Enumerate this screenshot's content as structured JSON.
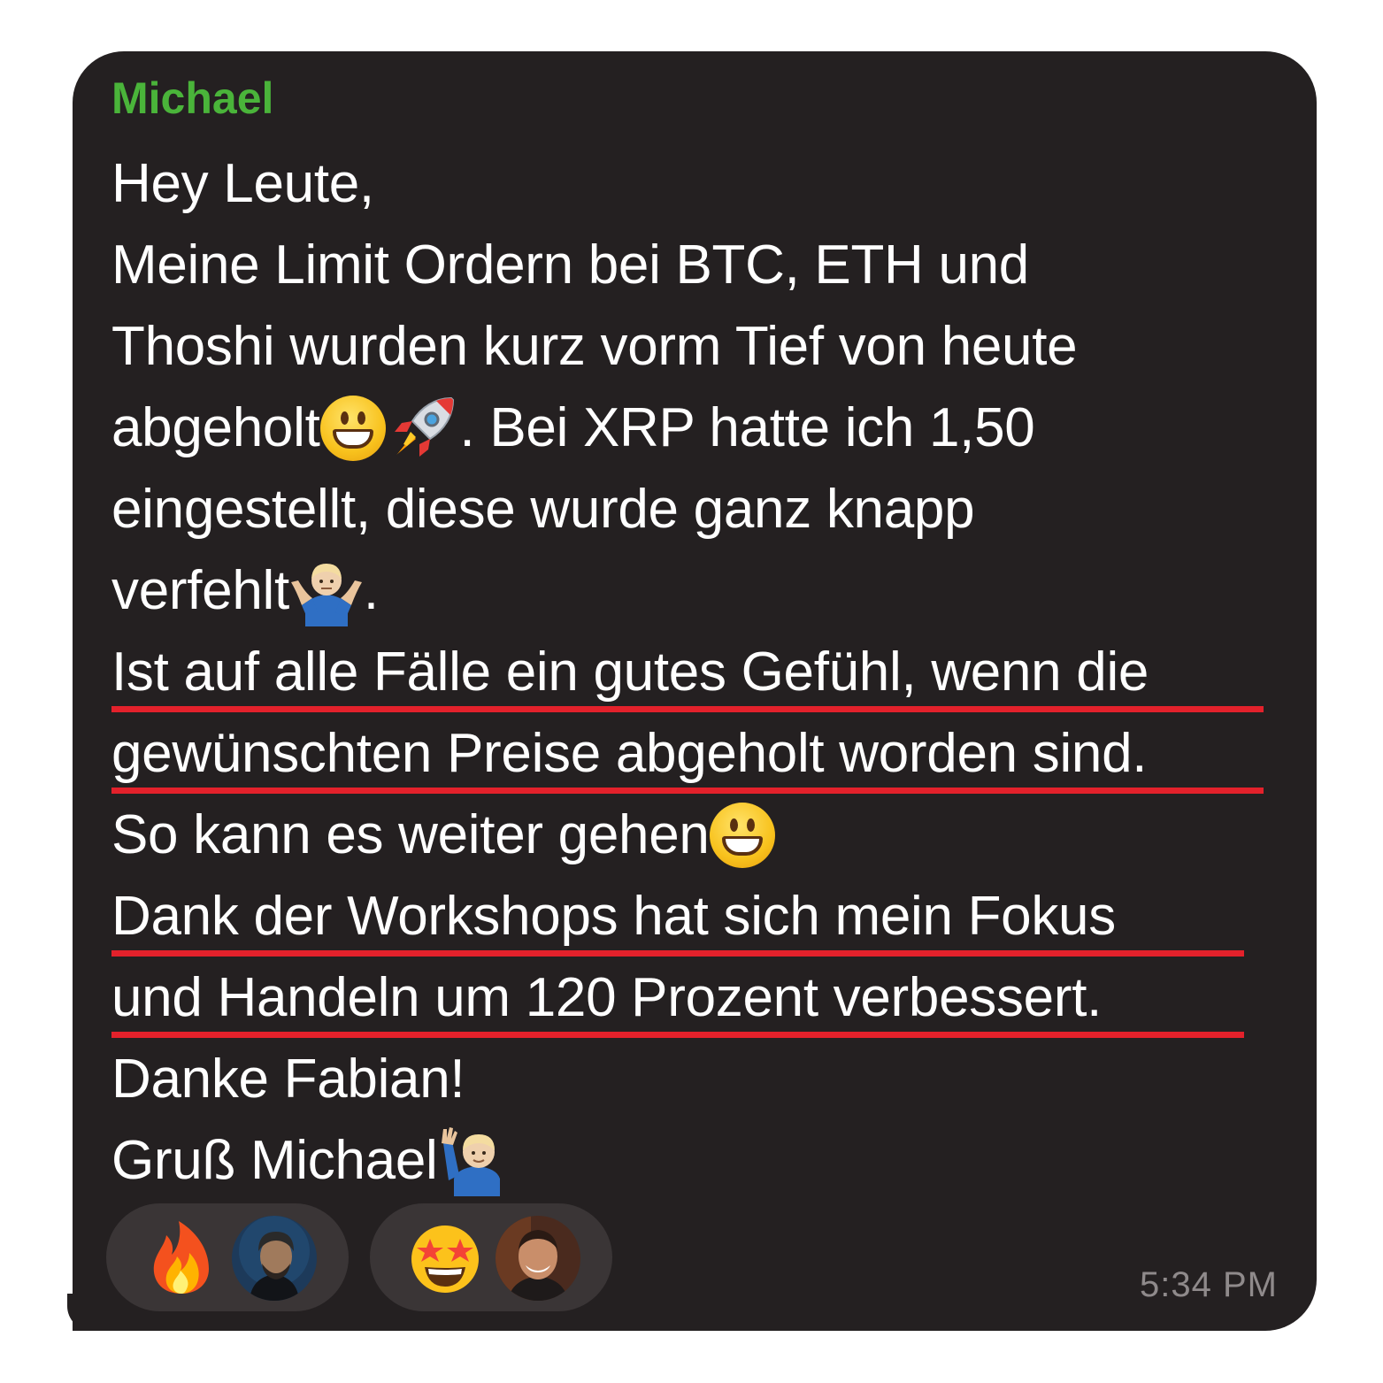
{
  "message": {
    "sender": "Michael",
    "time": "5:34 PM",
    "lines": [
      "Hey Leute,",
      "Meine Limit Ordern bei BTC, ETH und",
      "Thoshi wurden kurz vorm Tief von heute",
      "abgeholt",
      ". Bei XRP hatte ich 1,50",
      "eingestellt, diese wurde ganz knapp",
      "verfehlt ",
      ".",
      "Ist auf alle Fälle ein gutes Gefühl, wenn die",
      "gewünschten Preise abgeholt worden sind.",
      "So kann es weiter gehen",
      "Dank der Workshops hat sich mein Fokus",
      "und Handeln um 120 Prozent verbessert.",
      "Danke Fabian!",
      "Gruß Michael "
    ]
  },
  "reactions": [
    {
      "emoji": "fire-emoji",
      "user": "avatar-1"
    },
    {
      "emoji": "star-struck-emoji",
      "user": "avatar-2"
    }
  ],
  "colors": {
    "bubble": "#242021",
    "sender": "#4ab43a",
    "underline": "#e3212b",
    "timestamp": "#8f8a8b",
    "reaction_pill": "#3a3536"
  }
}
